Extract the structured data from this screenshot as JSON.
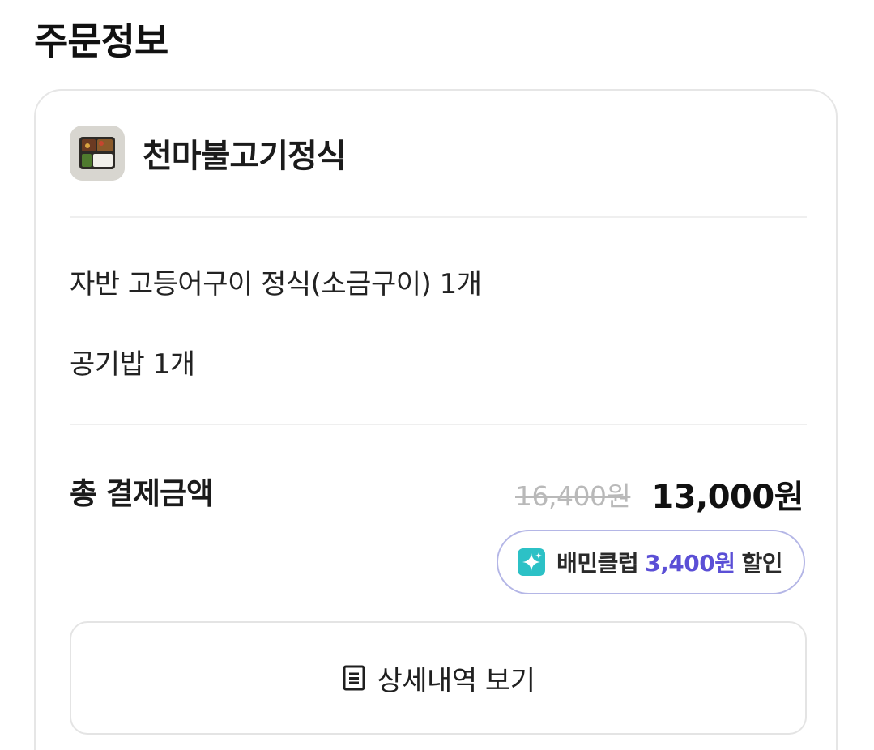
{
  "section_title": "주문정보",
  "store": {
    "name": "천마불고기정식",
    "thumbnail_icon": "food-thumbnail-image"
  },
  "items": [
    {
      "label": "자반 고등어구이 정식(소금구이) 1개"
    },
    {
      "label": "공기밥 1개"
    }
  ],
  "total": {
    "label": "총 결제금액",
    "original_price": "16,400원",
    "final_price": "13,000원"
  },
  "club_discount": {
    "icon": "sparkle-icon",
    "name": "배민클럽",
    "amount": "3,400원",
    "suffix": "할인",
    "accent_color": "#5b4fd6",
    "icon_color": "#2cc1c6"
  },
  "detail_button": {
    "icon": "receipt-list-icon",
    "label": "상세내역 보기"
  }
}
